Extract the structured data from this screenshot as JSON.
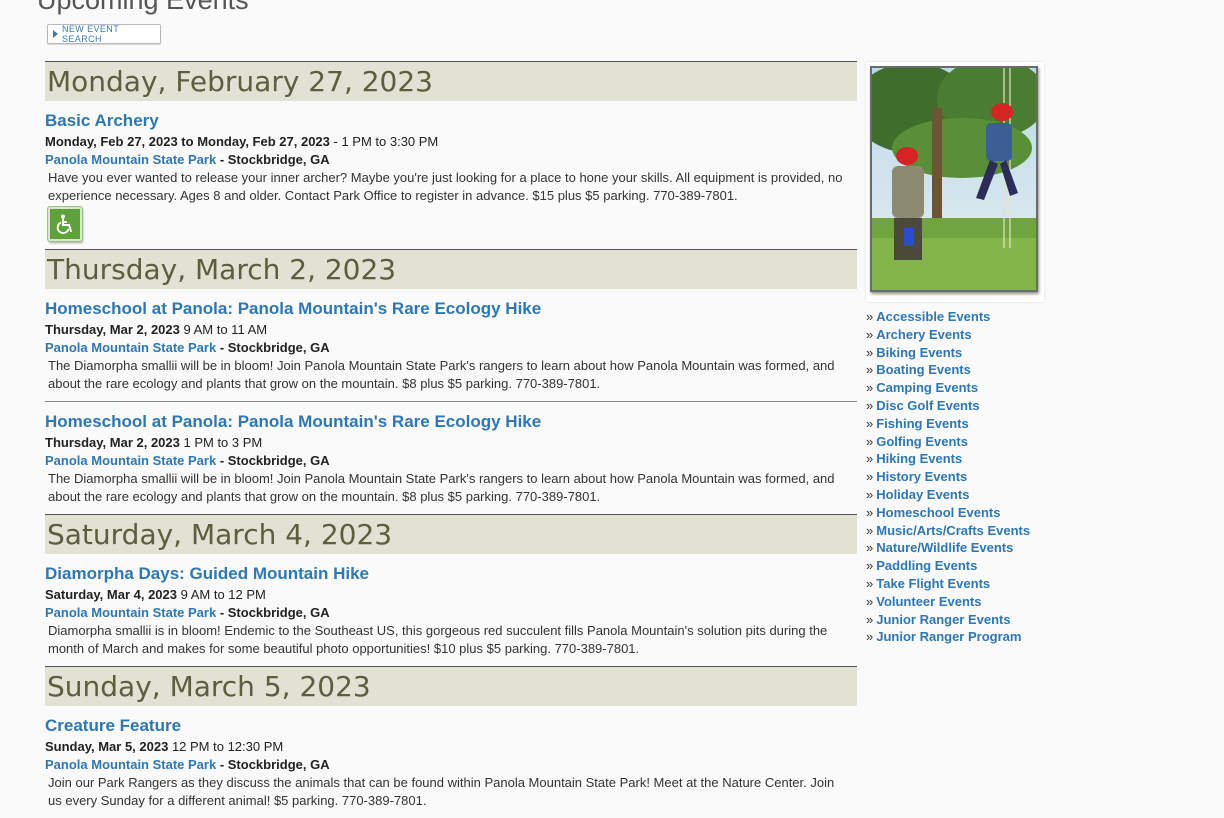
{
  "page": {
    "title": "Upcoming Events"
  },
  "search_button": {
    "label": "NEW EVENT SEARCH"
  },
  "days": [
    {
      "date": "Monday, February 27, 2023",
      "events": [
        {
          "title": "Basic Archery",
          "when_bold": "Monday, Feb 27, 2023 to Monday, Feb 27, 2023",
          "when_time": " - 1 PM to 3:30 PM",
          "park": "Panola Mountain State Park",
          "city": " - Stockbridge, GA",
          "desc": "Have you ever wanted to release your inner archer? Maybe you're just looking for a place to hone your skills. All equipment is provided, no experience necessary. Ages 8 and older. Contact Park Office to register in advance. $15 plus $5 parking. 770-389-7801."
        }
      ]
    },
    {
      "date": "Thursday, March 2, 2023",
      "events": [
        {
          "title": "Homeschool at Panola: Panola Mountain's Rare Ecology Hike",
          "when_bold": "Thursday, Mar 2, 2023",
          "when_time": " 9 AM to 11 AM",
          "park": "Panola Mountain State Park",
          "city": " - Stockbridge, GA",
          "desc": "The Diamorpha smallii will be in bloom! Join Panola Mountain State Park's rangers to learn about how Panola Mountain was formed, and about the rare ecology and plants that grow on the mountain. $8 plus $5 parking. 770-389-7801."
        },
        {
          "title": "Homeschool at Panola: Panola Mountain's Rare Ecology Hike",
          "when_bold": "Thursday, Mar 2, 2023",
          "when_time": " 1 PM to 3 PM",
          "park": "Panola Mountain State Park",
          "city": " - Stockbridge, GA",
          "desc": "The Diamorpha smallii will be in bloom! Join Panola Mountain State Park's rangers to learn about how Panola Mountain was formed, and about the rare ecology and plants that grow on the mountain. $8 plus $5 parking. 770-389-7801."
        }
      ]
    },
    {
      "date": "Saturday, March 4, 2023",
      "events": [
        {
          "title": "Diamorpha Days: Guided Mountain Hike",
          "when_bold": "Saturday, Mar 4, 2023",
          "when_time": " 9 AM to 12 PM",
          "park": "Panola Mountain State Park",
          "city": " - Stockbridge, GA",
          "desc": "Diamorpha smallii is in bloom! Endemic to the Southeast US, this gorgeous red succulent fills Panola Mountain's solution pits during the month of March and makes for some beautiful photo opportunities! $10 plus $5 parking. 770-389-7801."
        }
      ]
    },
    {
      "date": "Sunday, March 5, 2023",
      "events": [
        {
          "title": "Creature Feature",
          "when_bold": "Sunday, Mar 5, 2023",
          "when_time": " 12 PM to 12:30 PM",
          "park": "Panola Mountain State Park",
          "city": " - Stockbridge, GA",
          "desc": "Join our Park Rangers as they discuss the animals that can be found within Panola Mountain State Park! Meet at the Nature Center. Join us every Sunday for a different animal! $5 parking. 770-389-7801."
        }
      ]
    }
  ],
  "categories": [
    "Accessible Events",
    "Archery Events",
    "Biking Events",
    "Boating Events",
    "Camping Events",
    "Disc Golf Events",
    "Fishing Events",
    "Golfing Events",
    "Hiking Events",
    "History Events",
    "Holiday Events",
    "Homeschool Events",
    "Music/Arts/Crafts Events",
    "Nature/Wildlife Events",
    "Paddling Events",
    "Take Flight Events",
    "Volunteer Events",
    "Junior Ranger Events",
    "Junior Ranger Program"
  ],
  "icons": {
    "accessibility": "wheelchair-icon",
    "search_arrow": "triangle-right-icon"
  },
  "colors": {
    "link": "#2e77b5",
    "date_band": "#e2e2d4",
    "date_text": "#5d5d40",
    "access_icon": "#5fa23c"
  }
}
